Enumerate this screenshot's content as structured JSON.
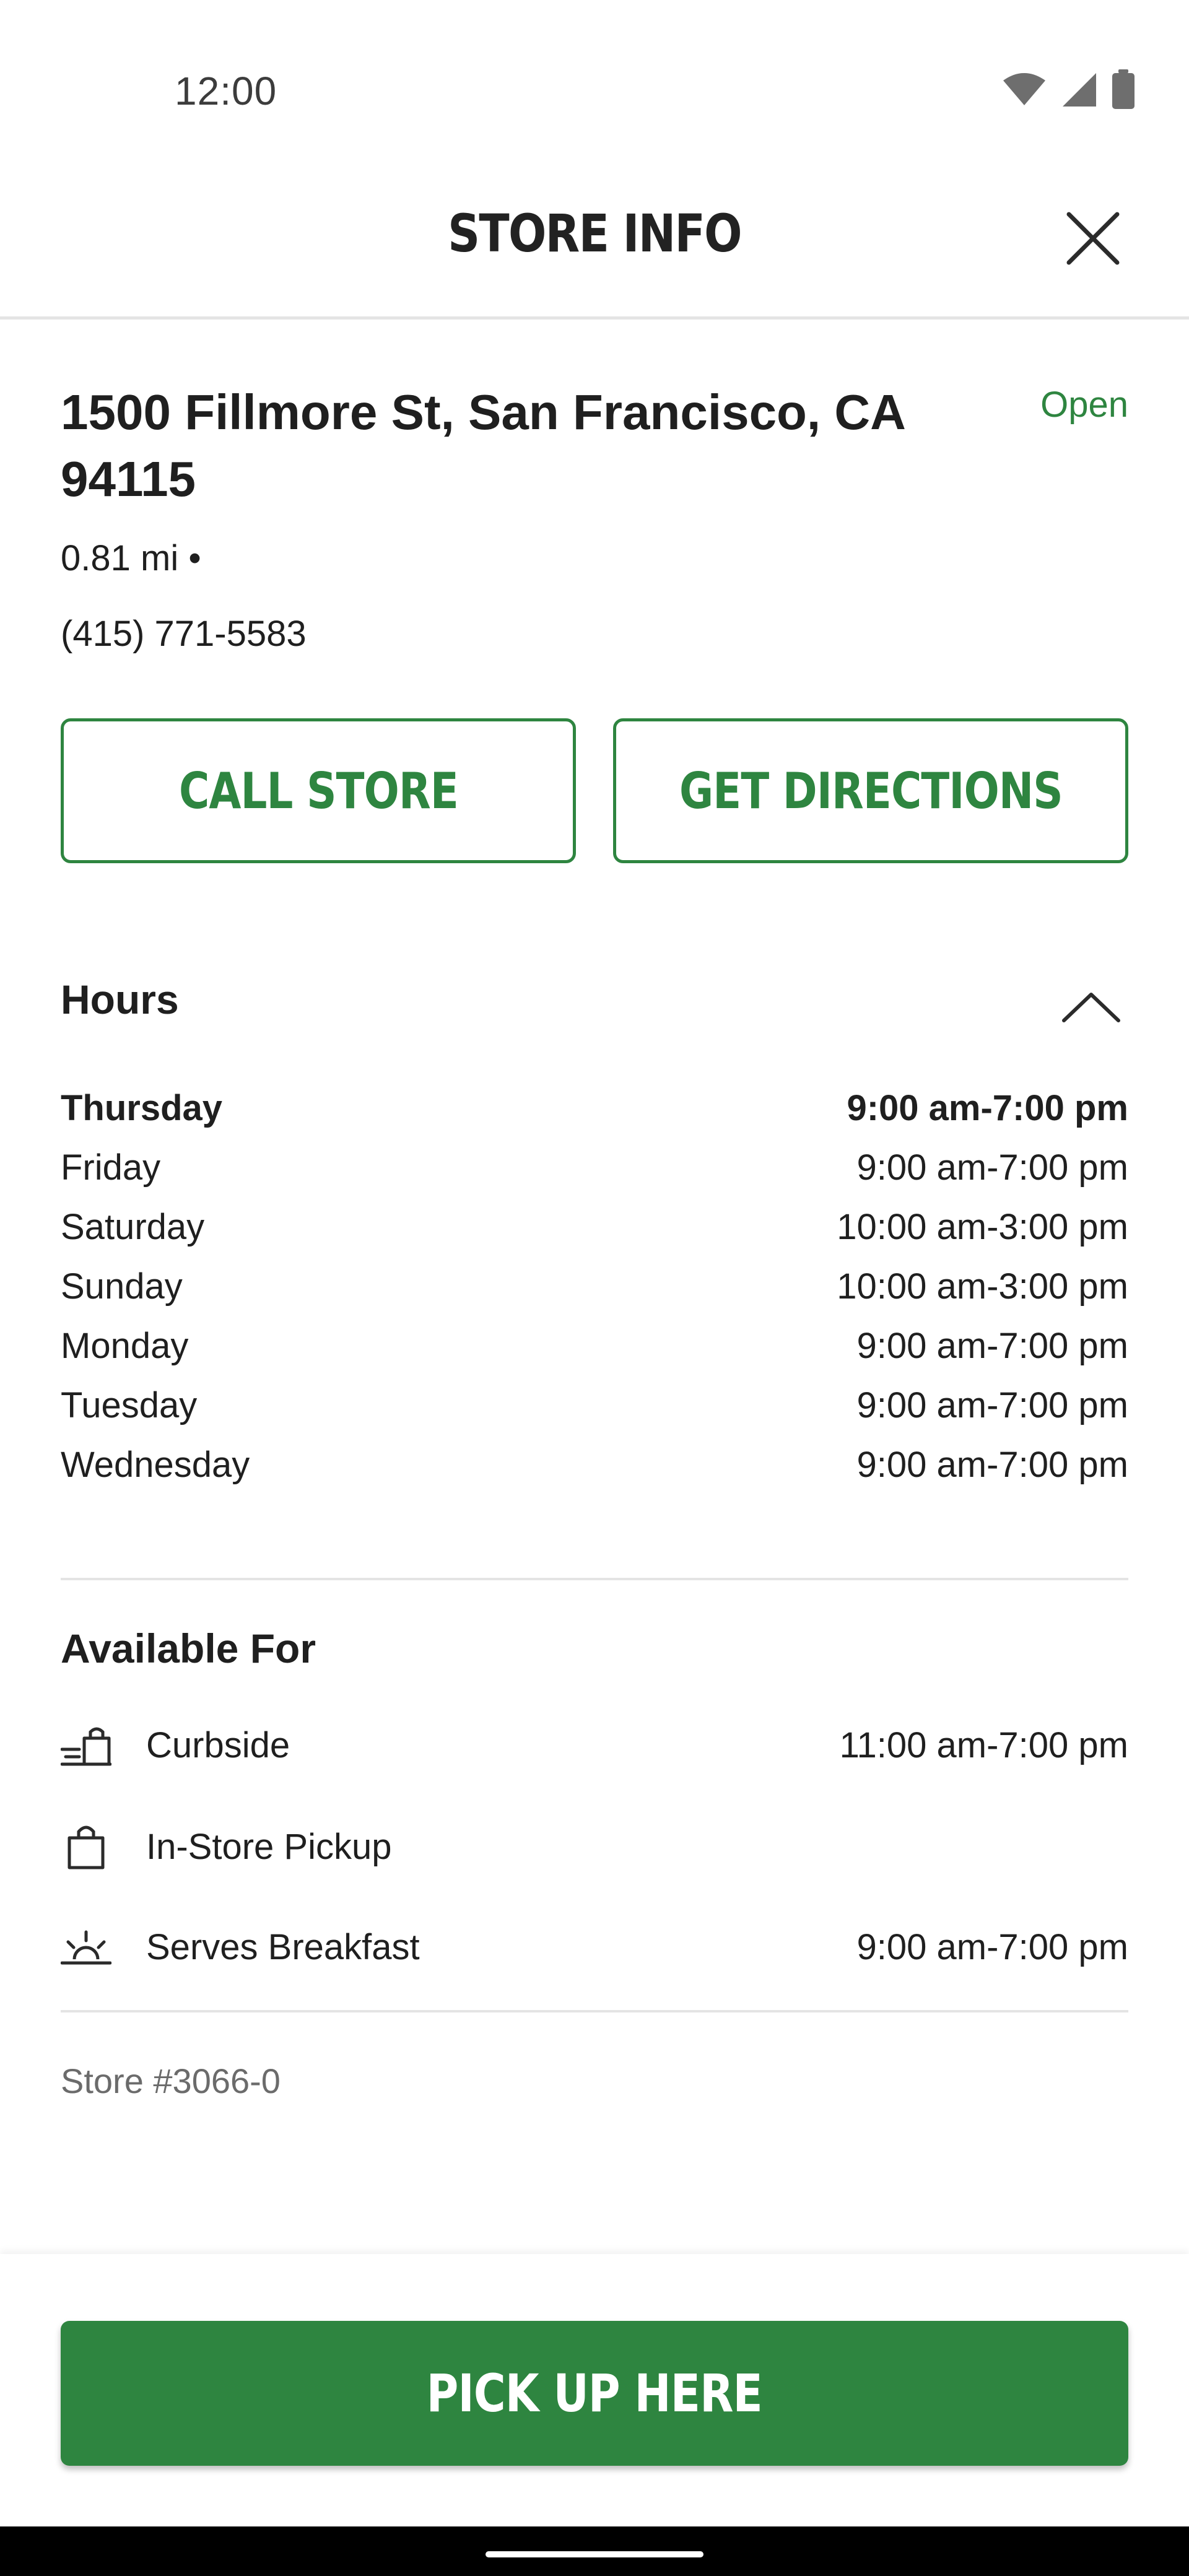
{
  "status_bar": {
    "time": "12:00",
    "icons": [
      "wifi-icon",
      "signal-icon",
      "battery-icon"
    ]
  },
  "header": {
    "title": "STORE INFO",
    "close_icon": "close-icon"
  },
  "store": {
    "address": "1500 Fillmore St, San Francisco, CA 94115",
    "status": "Open",
    "distance": "0.81 mi  •",
    "phone": "(415) 771-5583",
    "number": "Store #3066-0"
  },
  "actions": {
    "call_label": "CALL STORE",
    "directions_label": "GET DIRECTIONS",
    "pickup_label": "PICK UP HERE"
  },
  "hours": {
    "title": "Hours",
    "toggle_icon": "chevron-up-icon",
    "rows": [
      {
        "day": "Thursday",
        "time": "9:00 am-7:00 pm",
        "today": true
      },
      {
        "day": "Friday",
        "time": "9:00 am-7:00 pm",
        "today": false
      },
      {
        "day": "Saturday",
        "time": "10:00 am-3:00 pm",
        "today": false
      },
      {
        "day": "Sunday",
        "time": "10:00 am-3:00 pm",
        "today": false
      },
      {
        "day": "Monday",
        "time": "9:00 am-7:00 pm",
        "today": false
      },
      {
        "day": "Tuesday",
        "time": "9:00 am-7:00 pm",
        "today": false
      },
      {
        "day": "Wednesday",
        "time": "9:00 am-7:00 pm",
        "today": false
      }
    ]
  },
  "available": {
    "title": "Available For",
    "items": [
      {
        "label": "Curbside",
        "time": "11:00 am-7:00 pm",
        "icon": "curbside-icon"
      },
      {
        "label": "In-Store Pickup",
        "time": "",
        "icon": "shopping-bag-icon"
      },
      {
        "label": "Serves Breakfast",
        "time": "9:00 am-7:00 pm",
        "icon": "sunrise-icon"
      }
    ]
  },
  "colors": {
    "brand_green": "#2e8540",
    "divider": "#e4e4e4",
    "muted_text": "#6b6b6b"
  }
}
